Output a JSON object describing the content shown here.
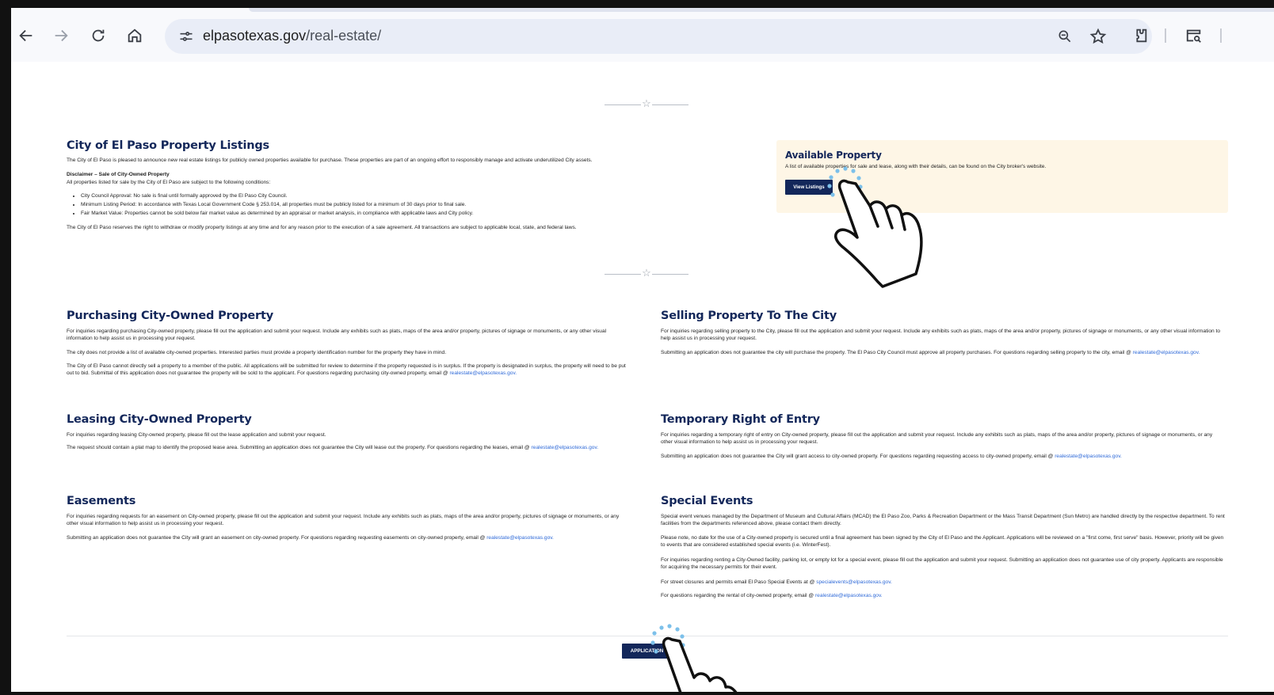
{
  "browser": {
    "url_host": "elpasotexas.gov",
    "url_path": "/real-estate/"
  },
  "listings": {
    "title": "City of El Paso Property Listings",
    "intro": "The City of El Paso is pleased to announce new real estate listings for publicly owned properties available for purchase. These properties are part of an ongoing effort to responsibly manage and activate underutilized City assets.",
    "disclaimer_title": "Disclaimer – Sale of City-Owned Property",
    "disclaimer_intro": "All properties listed for sale by the City of El Paso are subject to the following conditions:",
    "conditions": [
      "City Council Approval: No sale is final until formally approved by the El Paso City Council.",
      "Minimum Listing Period: In accordance with Texas Local Government Code § 253.014, all properties must be publicly listed for a minimum of 30 days prior to final sale.",
      "Fair Market Value: Properties cannot be sold below fair market value as determined by an appraisal or market analysis, in compliance with applicable laws and City policy."
    ],
    "reserve": "The City of El Paso reserves the right to withdraw or modify property listings at any time and for any reason prior to the execution of a sale agreement. All transactions are subject to applicable local, state, and federal laws."
  },
  "available": {
    "title": "Available Property",
    "text": "A list of available properties for sale and lease, along with their details, can be found on the City broker's website.",
    "button": "View Listings"
  },
  "purchasing": {
    "title": "Purchasing City-Owned Property",
    "p1": "For inquiries regarding purchasing City-owned property, please fill out the application and submit your request. Include any exhibits such as plats, maps of the area and/or property, pictures of signage or monuments, or any other visual information to help assist us in processing your request.",
    "p2": "The city does not provide a list of available city-owned properties. Interested parties must provide a property identification number for the property they have in mind.",
    "p3": "The City of El Paso cannot directly sell a property to a member of the public. All applications will be submitted for review to determine if the property requested is in surplus. If the property is designated in surplus, the property will need to be put out to bid. Submittal of this application does not guarantee the property will be sold to the applicant. For questions regarding purchasing city-owned property, email @",
    "email": "realestate@elpasotexas.gov."
  },
  "selling": {
    "title": "Selling Property To The City",
    "p1": "For inquiries regarding selling property to the City, please fill out the application and submit your request. Include any exhibits such as plats, maps of the area and/or property, pictures of signage or monuments, or any other visual information to help assist us in processing your request.",
    "p2": "Submitting an application does not guarantee the city will purchase the property. The El Paso City Council must approve all property purchases. For questions regarding selling property to the city, email @",
    "email": "realestate@elpasotexas.gov."
  },
  "leasing": {
    "title": "Leasing City-Owned Property",
    "p1": "For inquiries regarding leasing City-owned property, please fill out the lease application and submit your request.",
    "p2": "The request should contain a plat map to identify the proposed lease area. Submitting an application does not guarantee the City will lease out the property. For questions regarding the leases, email @",
    "email": "realestate@elpasotexas.gov."
  },
  "entry": {
    "title": "Temporary Right of Entry",
    "p1": "For inquiries regarding a temporary right of entry on City-owned property, please fill out the application and submit your request. Include any exhibits such as plats, maps of the area and/or property, pictures of signage or monuments, or any other visual information to help assist us in processing your request.",
    "p2": "Submitting an application does not guarantee the City will grant access to city-owned property. For questions regarding requesting access to city-owned property, email @",
    "email": "realestate@elpasotexas.gov."
  },
  "easements": {
    "title": "Easements",
    "p1": "For inquiries regarding requests for an easement on City-owned property, please fill out the application and submit your request. Include any exhibits such as plats, maps of the area and/or property, pictures of signage or monuments, or any other visual information to help assist us in processing your request.",
    "p2": "Submitting an application does not guarantee the City will grant an easement on city-owned property. For questions regarding requesting easements on city-owned property, email @",
    "email": "realestate@elpasotexas.gov."
  },
  "events": {
    "title": "Special Events",
    "p1": "Special event venues managed by the Department of Museum and Cultural Affairs (MCAD) the El Paso Zoo, Parks & Recreation Department or the Mass Transit Department (Sun Metro) are handled directly by the respective department. To rent facilities from the departments referenced above, please contact them directly.",
    "p2": "Please note, no date for the use of a City-owned property is secured until a final agreement has been signed by the City of El Paso and the Applicant. Applications will be reviewed on a \"first come, first serve\" basis. However, priority will be given to events that are considered established special events (i.e. WinterFest).",
    "p3": "For inquiries regarding renting a City-Owned facility, parking lot, or empty lot for a special event, please fill out the application and submit your request. Submitting an application does not guarantee use of city property. Applicants are responsible for acquiring the necessary permits for their event.",
    "p4": "For street closures and permits email El Paso Special Events at @",
    "email_events": "specialevents@elpasotexas.gov.",
    "p5": "For questions regarding the rental of city-owned property, email @",
    "email": "realestate@elpasotexas.gov."
  },
  "application_button": "APPLICATION",
  "icons": [
    "back-arrow-icon",
    "forward-arrow-icon",
    "reload-icon",
    "home-icon",
    "site-info-icon",
    "zoom-icon",
    "bookmark-star-icon",
    "extensions-icon",
    "tab-search-icon",
    "hand-pointer-icon"
  ]
}
